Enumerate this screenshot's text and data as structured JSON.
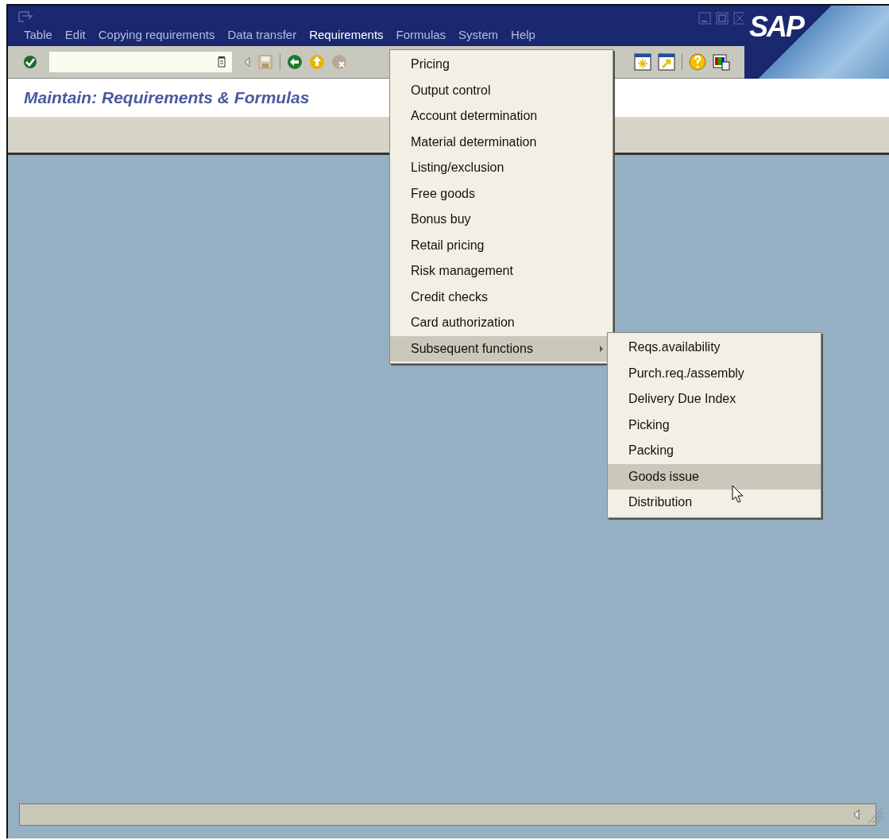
{
  "menu_bar": [
    {
      "label": "Table",
      "selected": false
    },
    {
      "label": "Edit",
      "selected": false
    },
    {
      "label": "Copying requirements",
      "selected": false
    },
    {
      "label": "Data transfer",
      "selected": false
    },
    {
      "label": "Requirements",
      "selected": true
    },
    {
      "label": "Formulas",
      "selected": false
    },
    {
      "label": "System",
      "selected": false
    },
    {
      "label": "Help",
      "selected": false
    }
  ],
  "logo": "SAP",
  "screen_title": "Maintain: Requirements & Formulas",
  "requirements_menu": [
    {
      "label": "Pricing",
      "selected": false,
      "submenu": false
    },
    {
      "label": "Output control",
      "selected": false,
      "submenu": false
    },
    {
      "label": "Account determination",
      "selected": false,
      "submenu": false
    },
    {
      "label": "Material determination",
      "selected": false,
      "submenu": false
    },
    {
      "label": "Listing/exclusion",
      "selected": false,
      "submenu": false
    },
    {
      "label": "Free goods",
      "selected": false,
      "submenu": false
    },
    {
      "label": "Bonus buy",
      "selected": false,
      "submenu": false
    },
    {
      "label": "Retail pricing",
      "selected": false,
      "submenu": false
    },
    {
      "label": "Risk management",
      "selected": false,
      "submenu": false
    },
    {
      "label": "Credit checks",
      "selected": false,
      "submenu": false
    },
    {
      "label": "Card authorization",
      "selected": false,
      "submenu": false
    },
    {
      "label": "Subsequent functions",
      "selected": true,
      "submenu": true
    }
  ],
  "subsequent_functions_menu": [
    {
      "label": "Reqs.availability",
      "selected": false
    },
    {
      "label": "Purch.req./assembly",
      "selected": false
    },
    {
      "label": "Delivery Due Index",
      "selected": false
    },
    {
      "label": "Picking",
      "selected": false
    },
    {
      "label": "Packing",
      "selected": false
    },
    {
      "label": "Goods issue",
      "selected": true
    },
    {
      "label": "Distribution",
      "selected": false
    }
  ]
}
